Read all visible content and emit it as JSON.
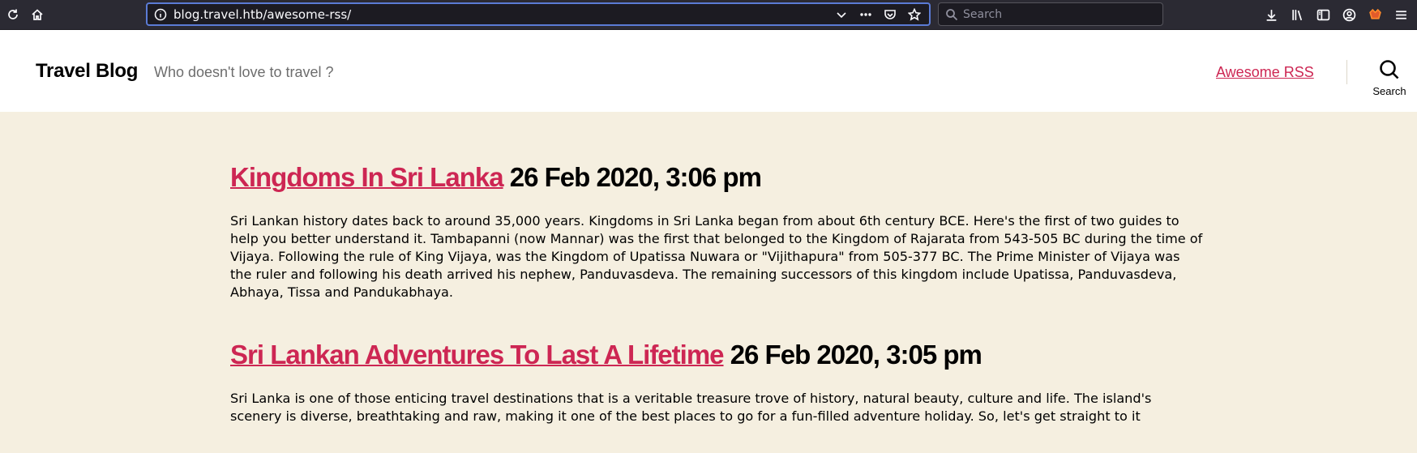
{
  "browser": {
    "url": "blog.travel.htb/awesome-rss/",
    "search_placeholder": "Search"
  },
  "site": {
    "title": "Travel Blog",
    "description": "Who doesn't love to travel ?",
    "nav_link": "Awesome RSS",
    "search_label": "Search"
  },
  "posts": [
    {
      "title": "Kingdoms In Sri Lanka",
      "date": "26 Feb 2020, 3:06 pm",
      "excerpt": "Sri Lankan history dates back to around 35,000 years. Kingdoms in Sri Lanka began from about 6th century BCE. Here's the first of two guides to help you better understand it. Tambapanni (now Mannar) was the first that belonged to the Kingdom of Rajarata from 543-505 BC during the time of Vijaya. Following the rule of King Vijaya, was the Kingdom of Upatissa Nuwara or \"Vijithapura\" from 505-377 BC. The Prime Minister of Vijaya was the ruler and following his death arrived his nephew, Panduvasdeva. The remaining successors of this kingdom include Upatissa, Panduvasdeva, Abhaya, Tissa and Pandukabhaya."
    },
    {
      "title": "Sri Lankan Adventures To Last A Lifetime",
      "date": "26 Feb 2020, 3:05 pm",
      "excerpt": "Sri Lanka is one of those enticing travel destinations that is a veritable treasure trove of history, natural beauty, culture and life. The island's scenery is diverse, breathtaking and raw, making it one of the best places to go for a fun-filled adventure holiday. So, let's get straight to it"
    }
  ],
  "colors": {
    "accent": "#cd2653",
    "background": "#f5efe0"
  }
}
